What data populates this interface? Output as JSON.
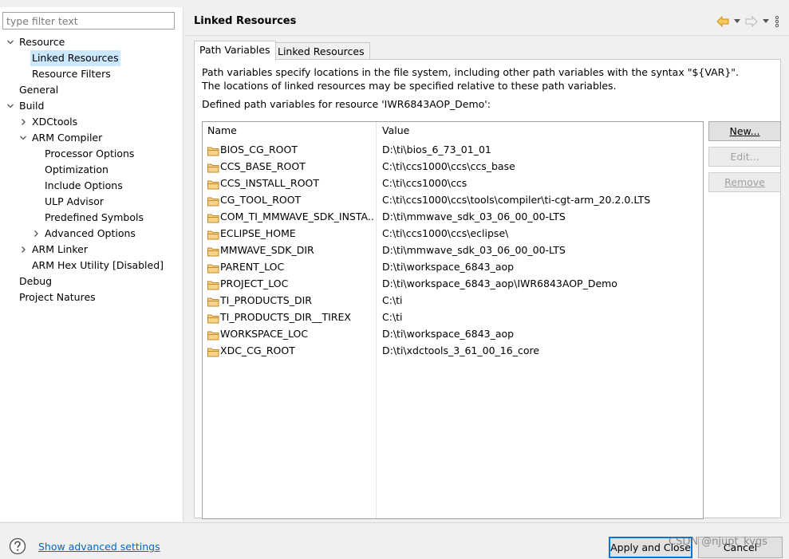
{
  "sidebar": {
    "filter_placeholder": "type filter text",
    "tree": [
      {
        "label": "Resource",
        "expanded": true
      },
      {
        "label": "Linked Resources",
        "selected": true
      },
      {
        "label": "Resource Filters"
      },
      {
        "label": "General"
      },
      {
        "label": "Build",
        "expanded": true
      },
      {
        "label": "XDCtools",
        "expanded": false
      },
      {
        "label": "ARM Compiler",
        "expanded": true
      },
      {
        "label": "Processor Options"
      },
      {
        "label": "Optimization"
      },
      {
        "label": "Include Options"
      },
      {
        "label": "ULP Advisor"
      },
      {
        "label": "Predefined Symbols"
      },
      {
        "label": "Advanced Options",
        "expanded": false
      },
      {
        "label": "ARM Linker",
        "expanded": false
      },
      {
        "label": "ARM Hex Utility  [Disabled]"
      },
      {
        "label": "Debug"
      },
      {
        "label": "Project Natures"
      }
    ]
  },
  "header": {
    "title": "Linked Resources",
    "nav_icons": [
      "back-arrow-icon",
      "dropdown-icon",
      "forward-arrow-icon",
      "dropdown-icon",
      "view-menu-icon"
    ]
  },
  "tabs": [
    {
      "label": "Path Variables",
      "active": true
    },
    {
      "label": "Linked Resources",
      "active": false
    }
  ],
  "path_variables": {
    "description_line1": "Path variables specify locations in the file system, including other path variables with the syntax \"${VAR}\".",
    "description_line2": "The locations of linked resources may be specified relative to these path variables.",
    "defined_label": "Defined path variables for resource 'IWR6843AOP_Demo':",
    "columns": [
      "Name",
      "Value"
    ],
    "rows": [
      {
        "name": "BIOS_CG_ROOT",
        "value": "D:\\ti\\bios_6_73_01_01"
      },
      {
        "name": "CCS_BASE_ROOT",
        "value": "C:\\ti\\ccs1000\\ccs\\ccs_base"
      },
      {
        "name": "CCS_INSTALL_ROOT",
        "value": "C:\\ti\\ccs1000\\ccs"
      },
      {
        "name": "CG_TOOL_ROOT",
        "value": "C:\\ti\\ccs1000\\ccs\\tools\\compiler\\ti-cgt-arm_20.2.0.LTS"
      },
      {
        "name": "COM_TI_MMWAVE_SDK_INSTA...",
        "value": "D:\\ti\\mmwave_sdk_03_06_00_00-LTS"
      },
      {
        "name": "ECLIPSE_HOME",
        "value": "C:\\ti\\ccs1000\\ccs\\eclipse\\"
      },
      {
        "name": "MMWAVE_SDK_DIR",
        "value": "D:\\ti\\mmwave_sdk_03_06_00_00-LTS"
      },
      {
        "name": "PARENT_LOC",
        "value": "D:\\ti\\workspace_6843_aop"
      },
      {
        "name": "PROJECT_LOC",
        "value": "D:\\ti\\workspace_6843_aop\\IWR6843AOP_Demo"
      },
      {
        "name": "TI_PRODUCTS_DIR",
        "value": "C:\\ti"
      },
      {
        "name": "TI_PRODUCTS_DIR__TIREX",
        "value": "C:\\ti"
      },
      {
        "name": "WORKSPACE_LOC",
        "value": "D:\\ti\\workspace_6843_aop"
      },
      {
        "name": "XDC_CG_ROOT",
        "value": "D:\\ti\\xdctools_3_61_00_16_core"
      }
    ],
    "buttons": {
      "new_label": "New...",
      "edit_label": "Edit...",
      "remove_label": "Remove"
    }
  },
  "footer": {
    "show_advanced_label": "Show advanced settings",
    "apply_close_label": "Apply and Close",
    "cancel_label": "Cancel",
    "watermark": "CSDN @njupt_kygs"
  },
  "colors": {
    "selection": "#cce8ff",
    "link": "#0066cc",
    "folder": "#e8b04a",
    "nav_arrow": "#e0a82e"
  }
}
